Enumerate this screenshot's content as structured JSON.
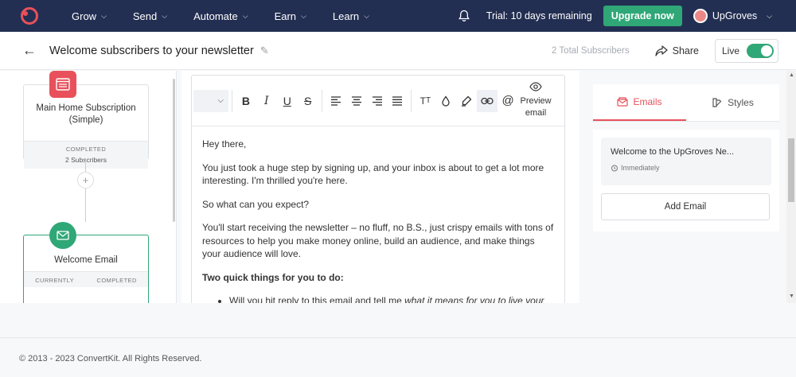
{
  "nav": {
    "items": [
      {
        "label": "Grow"
      },
      {
        "label": "Send"
      },
      {
        "label": "Automate"
      },
      {
        "label": "Earn"
      },
      {
        "label": "Learn"
      }
    ],
    "trial_text": "Trial: 10 days remaining",
    "upgrade_label": "Upgrade now",
    "user_name": "UpGroves"
  },
  "header": {
    "title": "Welcome subscribers to your newsletter",
    "total_subscribers": "2 Total Subscribers",
    "share_label": "Share",
    "live_label": "Live",
    "live_on": true
  },
  "workflow": {
    "trigger": {
      "title": "Main Home Subscription (Simple)",
      "status": "COMPLETED",
      "subscribers": "2 Subscribers"
    },
    "email_node": {
      "title": "Welcome Email",
      "col1": "CURRENTLY",
      "col2": "COMPLETED"
    }
  },
  "editor": {
    "preview_label_1": "Preview",
    "preview_label_2": "email",
    "paragraphs": [
      "Hey there,",
      "You just took a huge step by signing up, and your inbox is about to get a lot more interesting. I'm thrilled you're here.",
      "So what can you expect?",
      "You'll start receiving the newsletter – no fluff, no B.S., just crispy emails with tons of resources to help you make money online, build an audience, and make things your audience will love."
    ],
    "bold_heading": "Two quick things for you to do:",
    "bullet_1_normal": "Will you hit reply to this email and tell me ",
    "bullet_1_italic": "what it means for you to live your"
  },
  "sidebar": {
    "tab_emails": "Emails",
    "tab_styles": "Styles",
    "email_title": "Welcome to the UpGroves Ne...",
    "email_timing": "Immediately",
    "add_email_label": "Add Email"
  },
  "footer": {
    "copyright": "© 2013 - 2023 ConvertKit. All Rights Reserved."
  },
  "colors": {
    "nav_bg": "#232f52",
    "brand_red": "#e8515b",
    "green": "#2fa777"
  }
}
